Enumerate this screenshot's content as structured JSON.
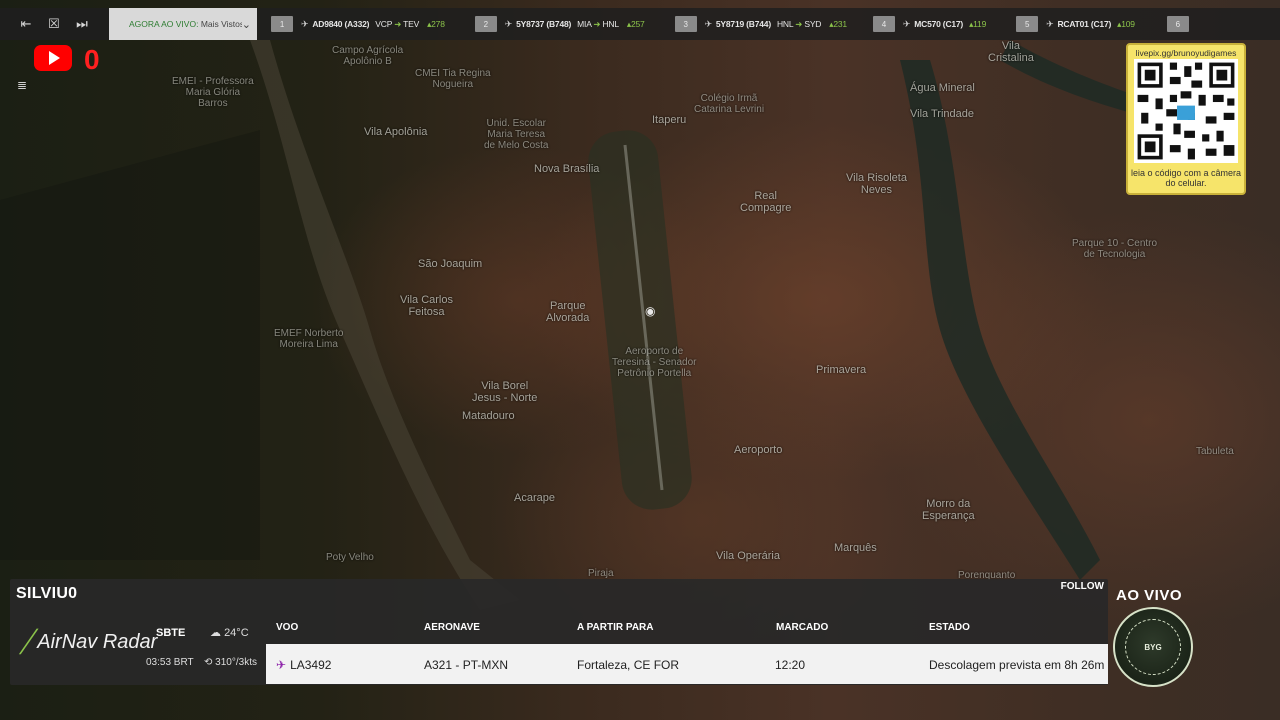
{
  "topbar": {
    "live_label": "AGORA AO VIVO:",
    "live_value": "Mais Vistos",
    "flights": [
      {
        "index": "1",
        "icon": "flight-icon",
        "callsign": "AD9840 (A332)",
        "from": "VCP",
        "to": "TEV",
        "speed": "278"
      },
      {
        "index": "2",
        "icon": "flight-icon",
        "callsign": "5Y8737 (B748)",
        "from": "MIA",
        "to": "HNL",
        "speed": "257"
      },
      {
        "index": "3",
        "icon": "flight-icon",
        "callsign": "5Y8719 (B744)",
        "from": "HNL",
        "to": "SYD",
        "speed": "231"
      },
      {
        "index": "4",
        "icon": "flight-icon",
        "callsign": "MC570 (C17)",
        "from": "",
        "to": "",
        "speed": "119"
      },
      {
        "index": "5",
        "icon": "flight-icon",
        "callsign": "RCAT01 (C17)",
        "from": "",
        "to": "",
        "speed": "109"
      },
      {
        "index": "6",
        "icon": "",
        "callsign": "",
        "from": "",
        "to": "",
        "speed": ""
      }
    ]
  },
  "overlay": {
    "youtube_count": "0"
  },
  "map": {
    "labels": [
      {
        "text": "Campo Agrícola\nApolônio B"
      },
      {
        "text": "EMEI - Professora\nMaria Glória\nBarros"
      },
      {
        "text": "CMEI Tia Regina\nNogueira"
      },
      {
        "text": "Vila Apolônia"
      },
      {
        "text": "Unid. Escolar\nMaria Teresa\nde Melo Costa"
      },
      {
        "text": "Nova Brasília"
      },
      {
        "text": "Itaperu"
      },
      {
        "text": "Colégio Irmã\nCatarina Levrini"
      },
      {
        "text": "Real\nCompagre"
      },
      {
        "text": "Água Mineral"
      },
      {
        "text": "Vila Trindade"
      },
      {
        "text": "Vila Risoleta\nNeves"
      },
      {
        "text": "Vila\nCristalina"
      },
      {
        "text": "São Joaquim"
      },
      {
        "text": "Vila Carlos\nFeitosa"
      },
      {
        "text": "Parque\nAlvorada"
      },
      {
        "text": "Aeroporto de\nTeresina - Senador\nPetrônio Portella"
      },
      {
        "text": "EMEF Norberto\nMoreira Lima"
      },
      {
        "text": "Vila Borel\nJesus - Norte"
      },
      {
        "text": "Matadouro"
      },
      {
        "text": "Primavera"
      },
      {
        "text": "Parque 10 - Centro\nde Tecnologia"
      },
      {
        "text": "Aeroporto"
      },
      {
        "text": "Acarape"
      },
      {
        "text": "Vila Operária"
      },
      {
        "text": "Morro da\nEsperança"
      },
      {
        "text": "Marquês"
      },
      {
        "text": "Piraja"
      },
      {
        "text": "Porenquanto"
      },
      {
        "text": "Poty Velho"
      },
      {
        "text": "Tabuleta"
      }
    ]
  },
  "qr": {
    "url": "livepix.gg/brunoyudigames",
    "caption": "leia o código com a câmera do celular."
  },
  "panel": {
    "title": "SILVIU0",
    "follow": "FOLLOW",
    "brand": "AirNav Radar",
    "airport_code": "SBTE",
    "local_time": "03:53 BRT",
    "temperature": "24°C",
    "wind": "310°/3kts",
    "headers": {
      "flight": "VOO",
      "aircraft": "AERONAVE",
      "route": "A PARTIR PARA",
      "scheduled": "MARCADO",
      "status": "ESTADO"
    },
    "row": {
      "flight": "LA3492",
      "aircraft": "A321 - PT-MXN",
      "route": "Fortaleza, CE FOR",
      "scheduled": "12:20",
      "status": "Descolagem prevista em 8h 26m"
    }
  },
  "badge": {
    "live_text": "AO VIVO",
    "channel_name": "BYG"
  },
  "colors": {
    "accent_green": "#8bc34a",
    "youtube_red": "#ff0000",
    "qr_yellow": "#f6e46a",
    "airline_purple": "#8e24aa"
  }
}
